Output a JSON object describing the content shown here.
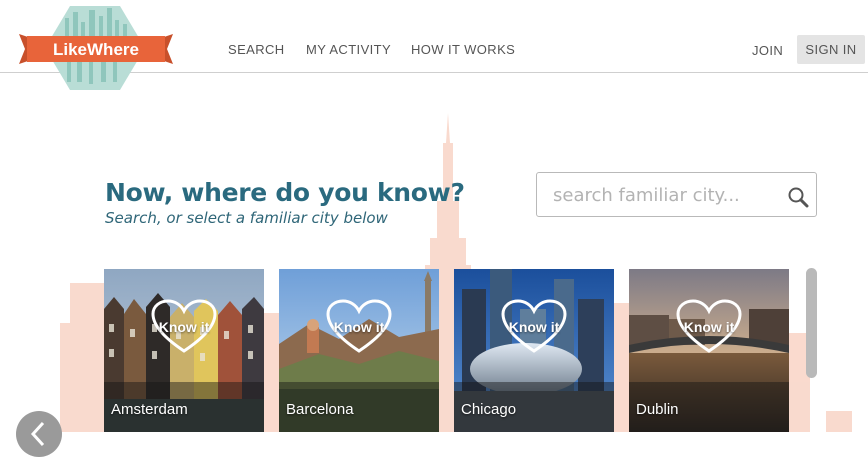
{
  "brand": {
    "logo_text": "LikeWhere"
  },
  "nav": [
    {
      "label": "SEARCH"
    },
    {
      "label": "MY ACTIVITY"
    },
    {
      "label": "HOW IT WORKS"
    }
  ],
  "auth": {
    "join_label": "JOIN",
    "signin_label": "SIGN IN"
  },
  "main": {
    "heading": "Now, where do you know?",
    "subheading": "Search, or select a familiar city below"
  },
  "search": {
    "placeholder": "search familiar city..."
  },
  "cities": [
    {
      "name": "Amsterdam",
      "badge": "Know it"
    },
    {
      "name": "Barcelona",
      "badge": "Know it"
    },
    {
      "name": "Chicago",
      "badge": "Know it"
    },
    {
      "name": "Dublin",
      "badge": "Know it"
    }
  ],
  "colors": {
    "heading": "#2a6a7f",
    "logo_banner": "#e8643a",
    "logo_badge": "#b9ddd6",
    "skyline": "#f7c9b8"
  }
}
